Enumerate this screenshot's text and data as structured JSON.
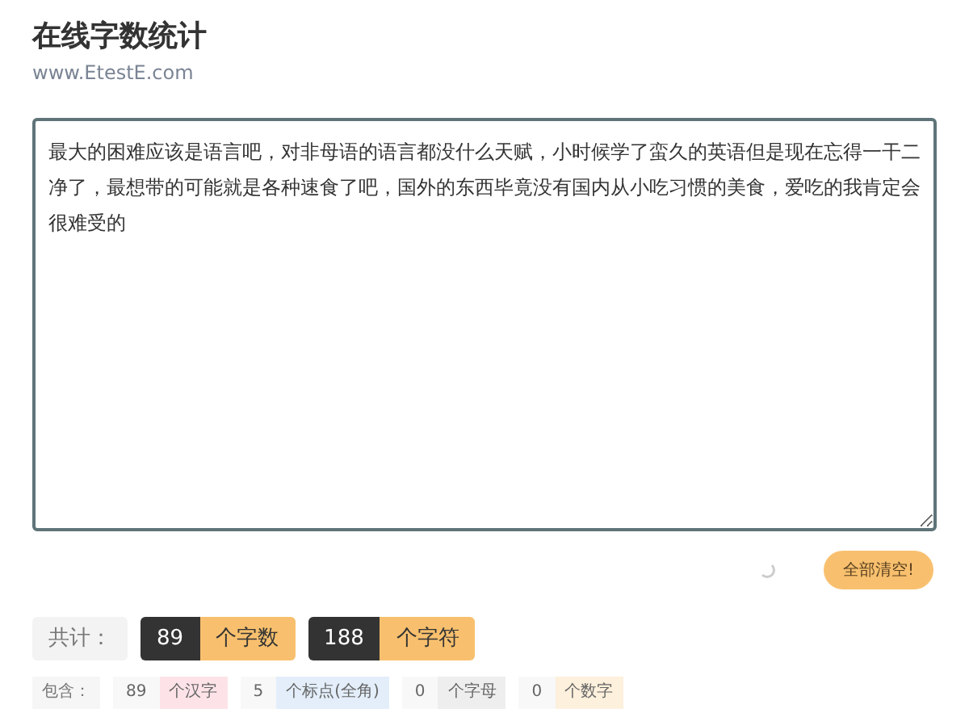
{
  "header": {
    "title": "在线字数统计",
    "subtitle": "www.EtestE.com"
  },
  "editor": {
    "value": "最大的困难应该是语言吧，对非母语的语言都没什么天赋，小时候学了蛮久的英语但是现在忘得一干二净了，最想带的可能就是各种速食了吧，国外的东西毕竟没有国内从小吃习惯的美食，爱吃的我肯定会很难受的"
  },
  "clear_button": "全部清空!",
  "totals": {
    "label": "共计：",
    "items": [
      {
        "count": "89",
        "unit": "个字数"
      },
      {
        "count": "188",
        "unit": "个字符"
      }
    ]
  },
  "details": {
    "label": "包含：",
    "items": [
      {
        "count": "89",
        "unit": "个汉字",
        "color": "#fde3e8"
      },
      {
        "count": "5",
        "unit": "个标点(全角)",
        "color": "#e3eefa"
      },
      {
        "count": "0",
        "unit": "个字母",
        "color": "#eeeeee"
      },
      {
        "count": "0",
        "unit": "个数字",
        "color": "#fdf0dc"
      }
    ]
  }
}
